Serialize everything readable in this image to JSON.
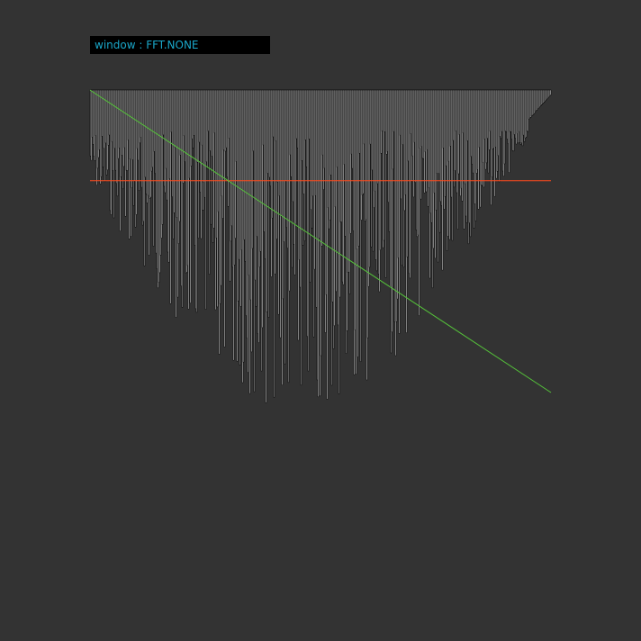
{
  "window_label": {
    "prefix": "window : ",
    "value": "FFT.NONE"
  },
  "colors": {
    "background": "#333333",
    "label_background": "#000000",
    "label_text": "#1aa7c9",
    "bar_fill": "#ffffff",
    "bar_outline": "#000000",
    "reference_line": "#ff4a1c",
    "slope_line": "#55c23a"
  },
  "spectrum": {
    "bins": 512,
    "reference_level": 0.24,
    "slope_end_level": 0.8,
    "depth_profile": "random-rising-toward-mid",
    "seed": 7
  }
}
